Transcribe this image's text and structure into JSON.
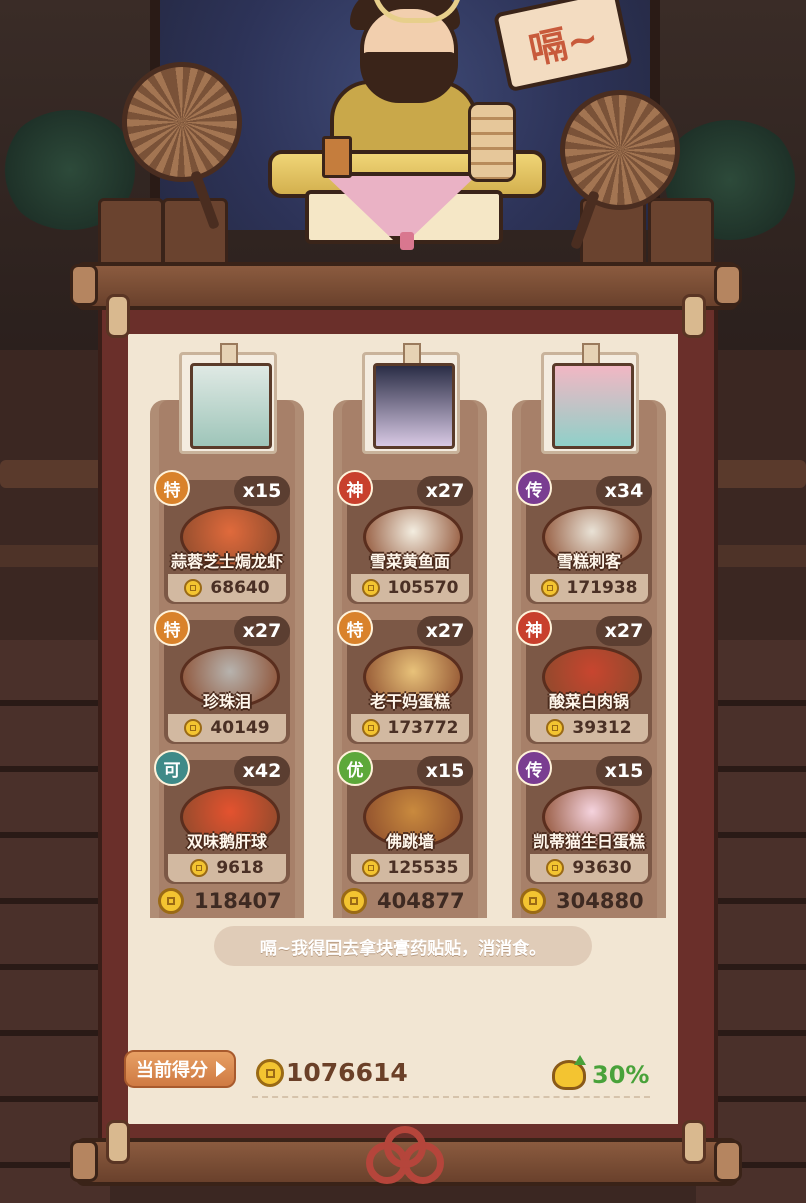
{
  "sign_text": "嗝~",
  "columns": [
    {
      "avatar_colors": [
        "#dfe9e4",
        "#9ec5b9"
      ],
      "dishes": [
        {
          "rarity": "特",
          "rarity_color": "#d9822b",
          "qty": "x15",
          "name": "蒜蓉芝士焗龙虾",
          "price": "68640",
          "dish_color": "#e06a3c"
        },
        {
          "rarity": "特",
          "rarity_color": "#d9822b",
          "qty": "x27",
          "name": "珍珠泪",
          "price": "40149",
          "dish_color": "#b7b3ae"
        },
        {
          "rarity": "可",
          "rarity_color": "#3f8a88",
          "qty": "x42",
          "name": "双味鹅肝球",
          "price": "9618",
          "dish_color": "#e4522f"
        }
      ],
      "total": "118407"
    },
    {
      "avatar_colors": [
        "#2a2d46",
        "#d8c9e4"
      ],
      "dishes": [
        {
          "rarity": "神",
          "rarity_color": "#c8402d",
          "qty": "x27",
          "name": "雪菜黄鱼面",
          "price": "105570",
          "dish_color": "#f3ede0"
        },
        {
          "rarity": "特",
          "rarity_color": "#d9822b",
          "qty": "x27",
          "name": "老干妈蛋糕",
          "price": "173772",
          "dish_color": "#e8c27a"
        },
        {
          "rarity": "优",
          "rarity_color": "#5da83a",
          "qty": "x15",
          "name": "佛跳墙",
          "price": "125535",
          "dish_color": "#c98a3e"
        }
      ],
      "total": "404877"
    },
    {
      "avatar_colors": [
        "#f2b7c4",
        "#8fd0c8"
      ],
      "dishes": [
        {
          "rarity": "传",
          "rarity_color": "#7a3d91",
          "qty": "x34",
          "name": "雪糕刺客",
          "price": "171938",
          "dish_color": "#e9e2d6"
        },
        {
          "rarity": "神",
          "rarity_color": "#c8402d",
          "qty": "x27",
          "name": "酸菜白肉锅",
          "price": "39312",
          "dish_color": "#c8452f"
        },
        {
          "rarity": "传",
          "rarity_color": "#7a3d91",
          "qty": "x15",
          "name": "凯蒂猫生日蛋糕",
          "price": "93630",
          "dish_color": "#f5d3de"
        }
      ],
      "total": "304880"
    }
  ],
  "speech": "嗝~我得回去拿块膏药贴贴，消消食。",
  "score": {
    "label": "当前得分",
    "value": "1076614",
    "bonus": "30%"
  },
  "colors": {
    "coin": "#f3c431",
    "bonus_green": "#49a23a",
    "board": "#f2e6d3",
    "frame": "#6a2f2a"
  }
}
